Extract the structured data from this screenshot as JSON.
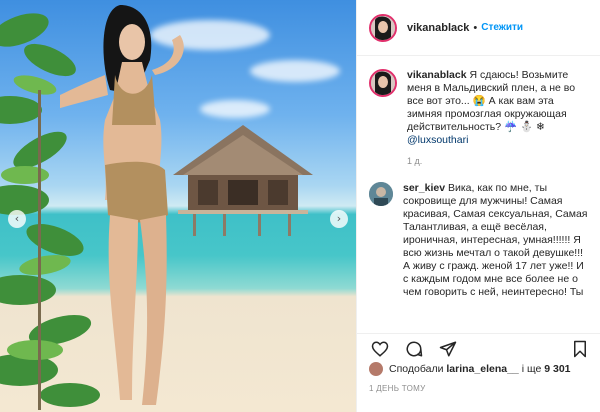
{
  "post": {
    "username": "vikanablack",
    "follow_label": "Стежити"
  },
  "caption": {
    "username": "vikanablack",
    "text": "Я сдаюсь! Возьмите меня в Мальдивский плен, а не во все вот это... 😭 А как вам эта зимняя промозглая окружающая действительность? ☔ ⛄ ❄ ",
    "mention": "@luxsouthari",
    "time": "1 д."
  },
  "comments": [
    {
      "username": "ser_kiev",
      "text": "Вика, как по мне, ты сокровище для мужчины! Самая красивая, Самая сексуальная, Самая Талантливая, а ещё весёлая, ироничная, интересная, умная!!!!!! Я всю жизнь мечтал о такой девушке!!! А живу с гражд. женой 17 лет уже!! И с каждым годом мне все более не о чем говорить с ней, неинтересно! Ты"
    }
  ],
  "likes": {
    "prefix": "Сподобали",
    "user": "larina_elena__",
    "middle": "і ще",
    "count": "9 301"
  },
  "time_ago": "1 ДЕНЬ ТОМУ",
  "icons": {
    "like": "heart-icon",
    "comment": "comment-icon",
    "share": "share-icon",
    "save": "bookmark-icon",
    "prev": "chevron-left-icon",
    "next": "chevron-right-icon"
  },
  "colors": {
    "follow": "#0095f6",
    "story_ring": "#e1306c",
    "muted": "#8e8e8e"
  }
}
